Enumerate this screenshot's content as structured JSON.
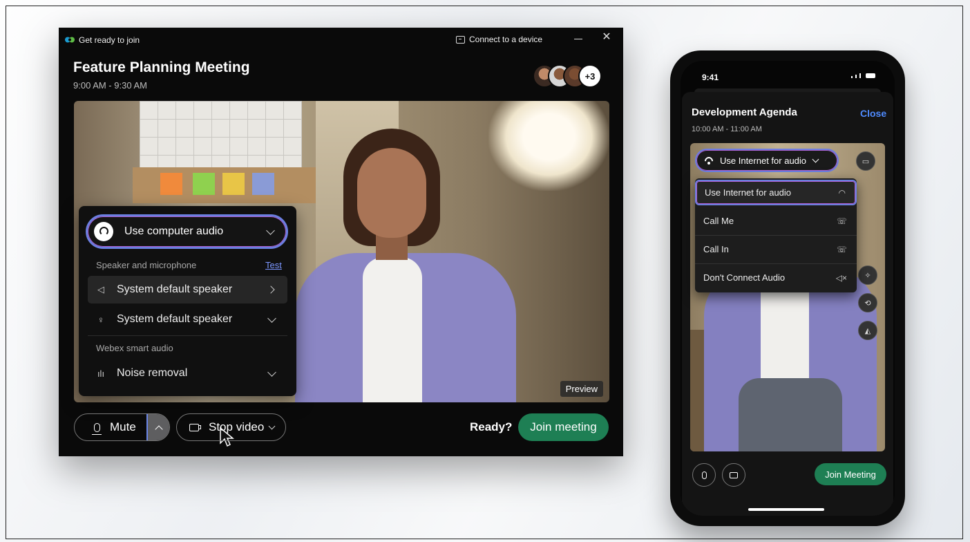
{
  "desktop": {
    "window_title": "Get ready to join",
    "connect_device": "Connect to a device",
    "meeting_title": "Feature Planning Meeting",
    "meeting_time": "9:00 AM - 9:30 AM",
    "participants_more": "+3",
    "preview_label": "Preview",
    "audio_panel": {
      "selected_option": "Use computer audio",
      "speaker_mic_label": "Speaker and microphone",
      "test_link": "Test",
      "speaker_device": "System default speaker",
      "microphone_device": "System default speaker",
      "smart_audio_label": "Webex smart audio",
      "noise_option": "Noise removal"
    },
    "controls": {
      "mute_label": "Mute",
      "video_label": "Stop video",
      "ready_label": "Ready?",
      "join_label": "Join meeting"
    },
    "colors": {
      "join": "#1e7f54",
      "highlight_border": "#6b7fe0"
    }
  },
  "phone": {
    "status_time": "9:41",
    "meeting_title": "Development Agenda",
    "close_label": "Close",
    "meeting_time": "10:00 AM - 11:00 AM",
    "audio_selected": "Use Internet for audio",
    "audio_menu": [
      {
        "label": "Use Internet for audio",
        "icon": "wifi-icon"
      },
      {
        "label": "Call Me",
        "icon": "phone-out-icon"
      },
      {
        "label": "Call In",
        "icon": "phone-in-icon"
      },
      {
        "label": "Don't Connect Audio",
        "icon": "speaker-mute-icon"
      }
    ],
    "join_label": "Join Meeting"
  }
}
